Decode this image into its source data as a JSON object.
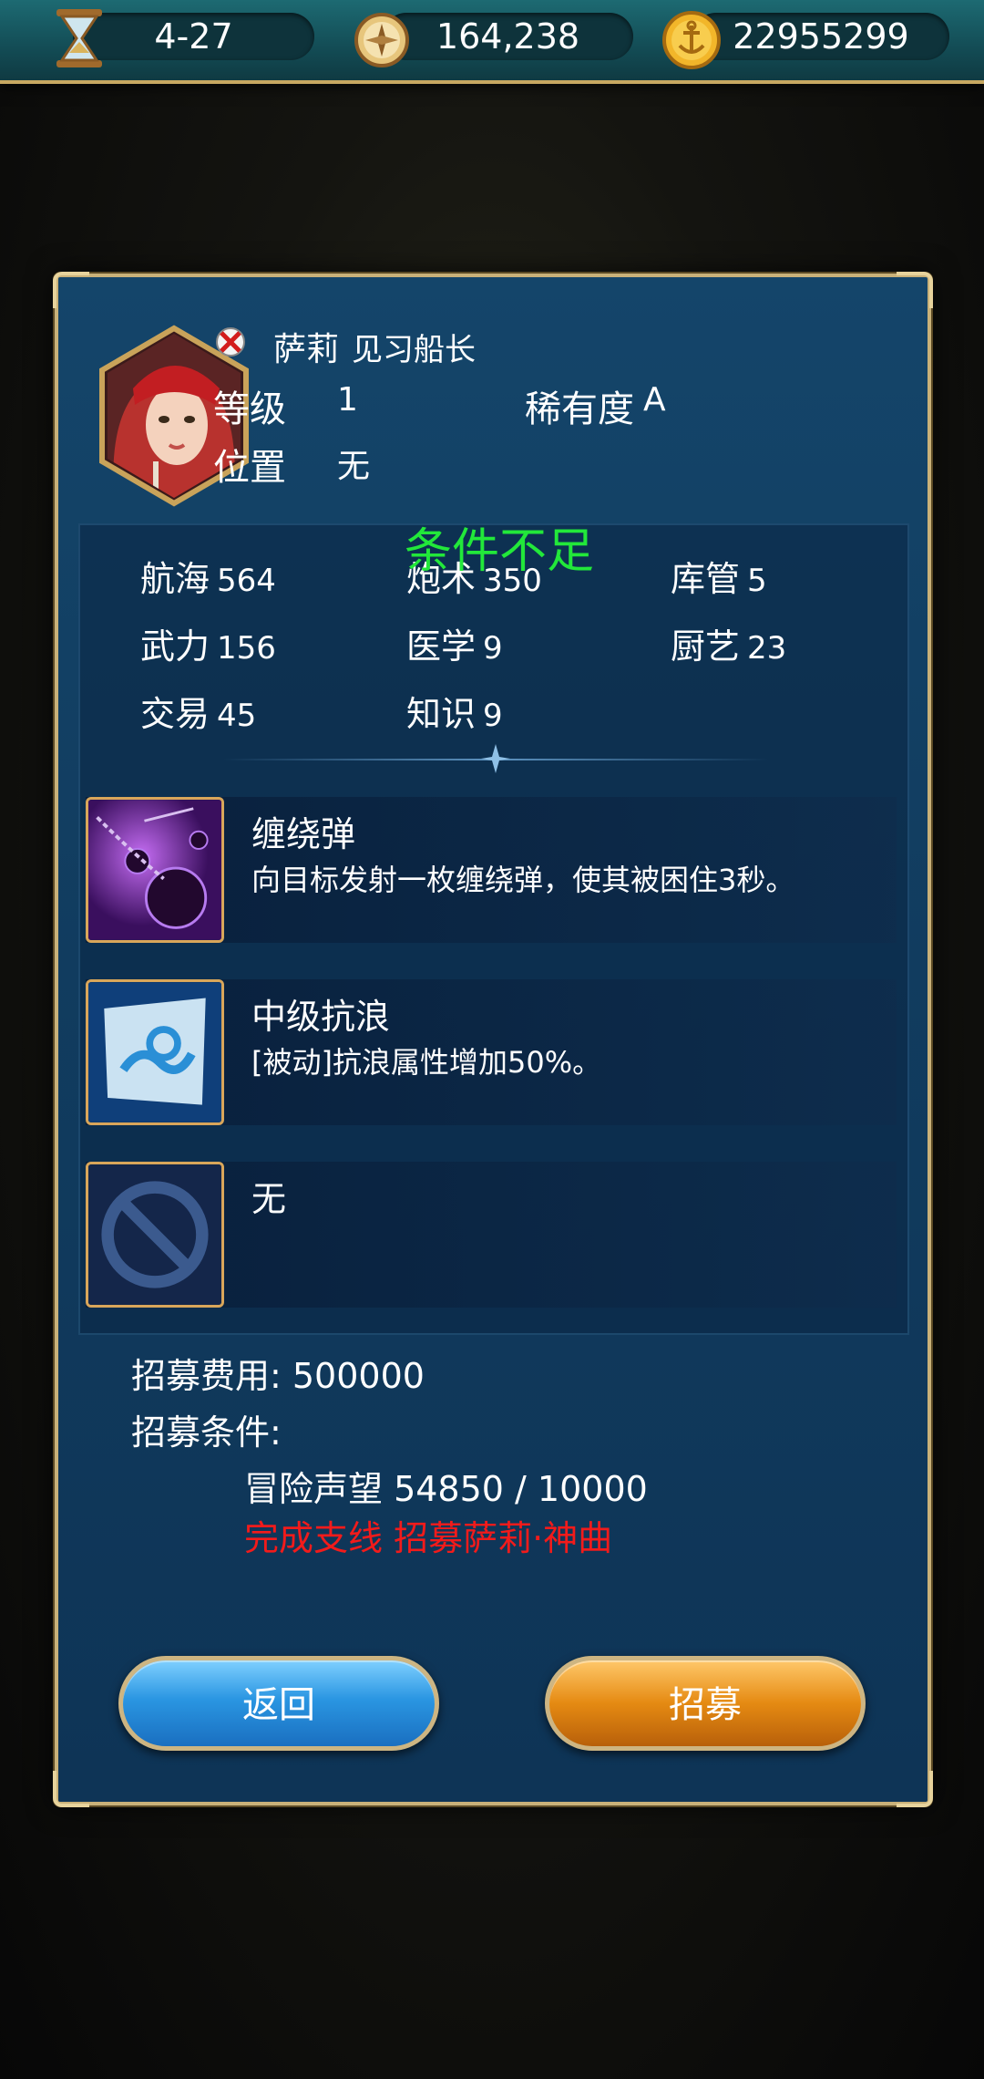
{
  "topbar": {
    "date": "4-27",
    "reputation": "164,238",
    "gold": "22955299"
  },
  "officer": {
    "name": "萨莉",
    "title": "见习船长",
    "level_label": "等级",
    "level_value": "1",
    "rarity_label": "稀有度",
    "rarity_value": "A",
    "position_label": "位置",
    "position_value": "无",
    "status": "条件不足"
  },
  "stats": [
    {
      "label": "航海",
      "value": "564"
    },
    {
      "label": "炮术",
      "value": "350"
    },
    {
      "label": "库管",
      "value": "5"
    },
    {
      "label": "武力",
      "value": "156"
    },
    {
      "label": "医学",
      "value": "9"
    },
    {
      "label": "厨艺",
      "value": "23"
    },
    {
      "label": "交易",
      "value": "45"
    },
    {
      "label": "知识",
      "value": "9"
    }
  ],
  "skills": [
    {
      "name": "缠绕弹",
      "desc": "向目标发射一枚缠绕弹，使其被困住3秒。",
      "icon": "chain-shot-icon"
    },
    {
      "name": "中级抗浪",
      "desc": "[被动]抗浪属性增加50%。",
      "icon": "wave-resist-icon"
    },
    {
      "name": "无",
      "desc": "",
      "icon": "no-skill-icon"
    }
  ],
  "recruit": {
    "cost_text": "招募费用: 500000",
    "cond_label": "招募条件:",
    "cond_fame": "冒险声望 54850 / 10000",
    "cond_quest": "完成支线 招募萨莉·神曲"
  },
  "buttons": {
    "back": "返回",
    "recruit": "招募"
  },
  "colors": {
    "status_green": "#22e83a",
    "unmet_red": "#f21b1b",
    "frame_gold": "#c9b179"
  }
}
